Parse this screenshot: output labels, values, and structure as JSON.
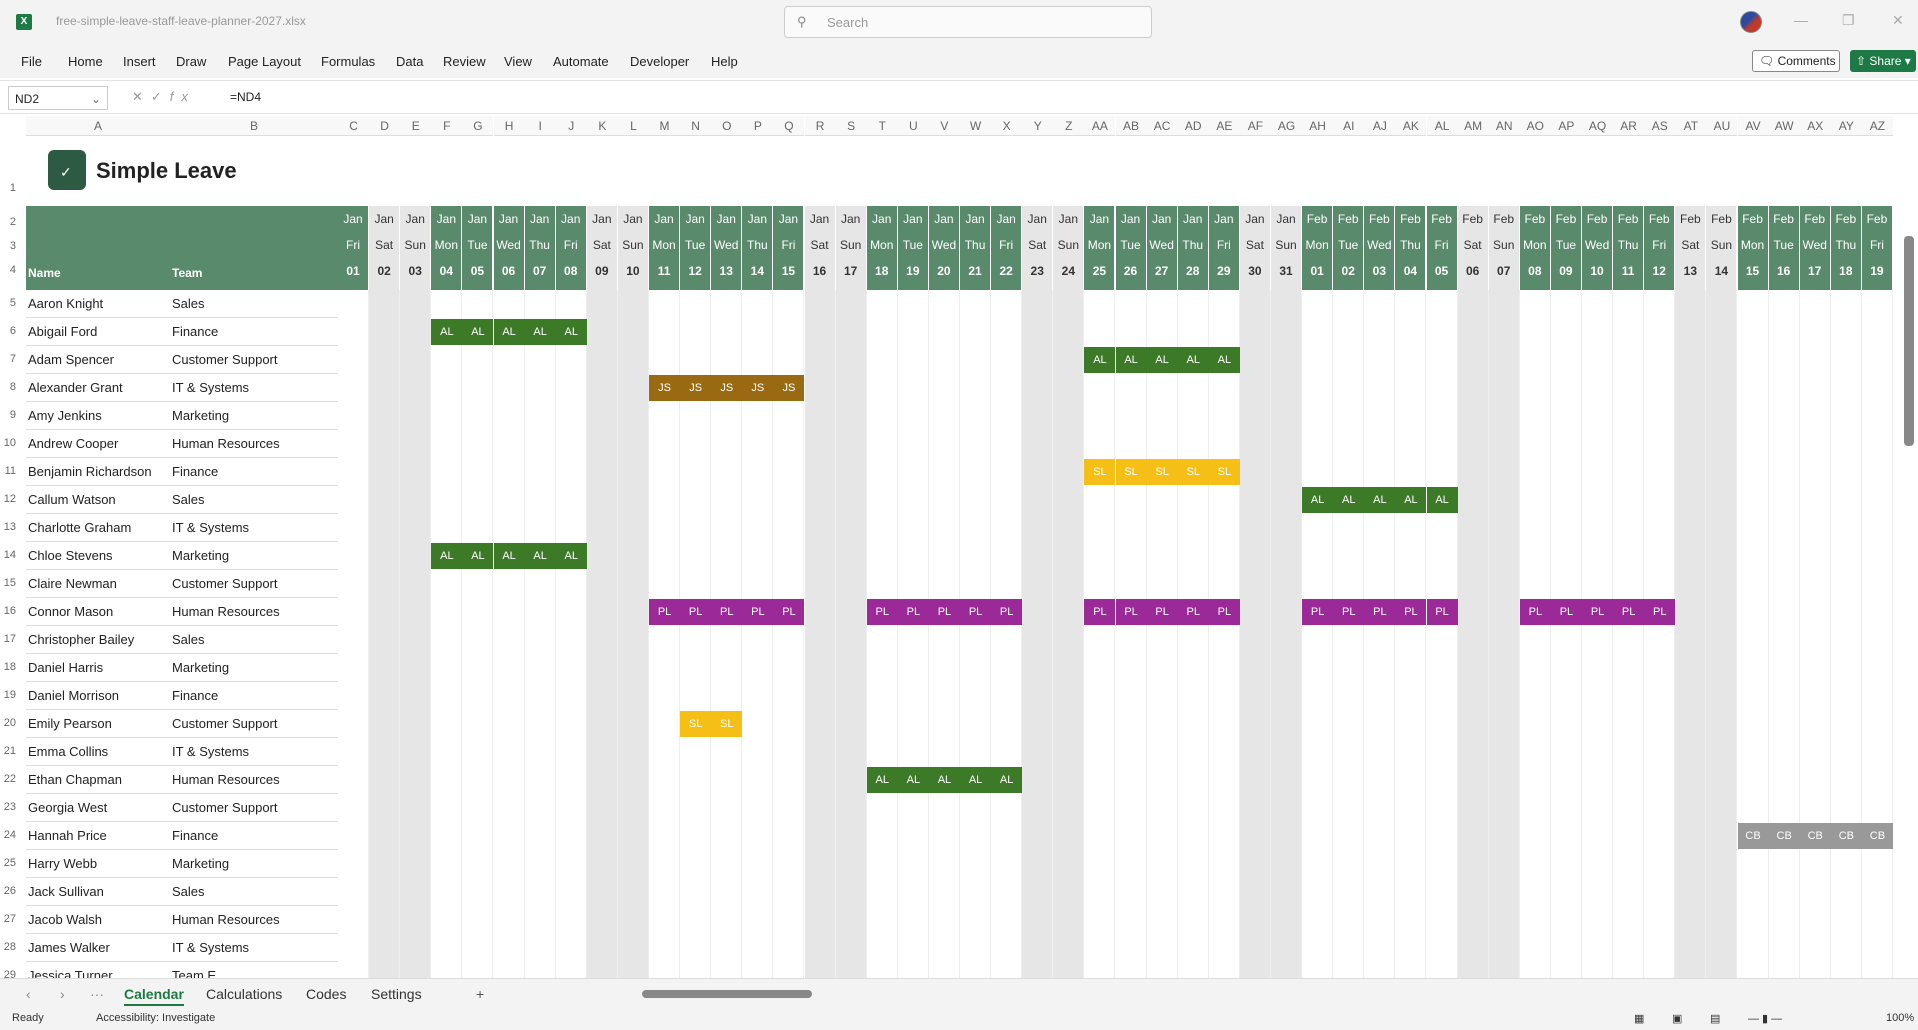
{
  "app": {
    "file_name": "free-simple-leave-staff-leave-planner-2027.xlsx",
    "search_placeholder": "Search",
    "brand_color": "#1d7a45"
  },
  "menu": [
    "File",
    "Home",
    "Insert",
    "Draw",
    "Page Layout",
    "Formulas",
    "Data",
    "Review",
    "View",
    "Automate",
    "Developer",
    "Help"
  ],
  "toolbar": {
    "comments_label": "Comments",
    "share_label": "Share"
  },
  "formula_bar": {
    "name_box": "ND2",
    "fx_label": "fx",
    "formula": "=ND4"
  },
  "sheet": {
    "columns": [
      "A",
      "B",
      "C",
      "D",
      "E",
      "F",
      "G",
      "H",
      "I",
      "J",
      "K",
      "L",
      "M",
      "N",
      "O",
      "P",
      "Q",
      "R",
      "S",
      "T",
      "U",
      "V",
      "W",
      "X",
      "Y",
      "Z",
      "AA",
      "AB",
      "AC",
      "AD",
      "AE",
      "AF",
      "AG",
      "AH",
      "AI",
      "AJ",
      "AK",
      "AL",
      "AM",
      "AN",
      "AO",
      "AP",
      "AQ",
      "AR",
      "AS",
      "AT",
      "AU",
      "AV",
      "AW",
      "AX",
      "AY",
      "AZ"
    ],
    "row_numbers": [
      1,
      2,
      3,
      4,
      5,
      6,
      7,
      8,
      9,
      10,
      11,
      12,
      13,
      14,
      15,
      16,
      17,
      18,
      19,
      20,
      21,
      22,
      23,
      24,
      25,
      26,
      27,
      28,
      29
    ],
    "logo_text": "Simple Leave",
    "header_name": "Name",
    "header_team": "Team",
    "header_color": "#5a8a6c",
    "weekend_color": "#e6e6e6",
    "days": [
      {
        "m": "Jan",
        "wd": "Fri",
        "d": "01"
      },
      {
        "m": "Jan",
        "wd": "Sat",
        "d": "02"
      },
      {
        "m": "Jan",
        "wd": "Sun",
        "d": "03"
      },
      {
        "m": "Jan",
        "wd": "Mon",
        "d": "04"
      },
      {
        "m": "Jan",
        "wd": "Tue",
        "d": "05"
      },
      {
        "m": "Jan",
        "wd": "Wed",
        "d": "06"
      },
      {
        "m": "Jan",
        "wd": "Thu",
        "d": "07"
      },
      {
        "m": "Jan",
        "wd": "Fri",
        "d": "08"
      },
      {
        "m": "Jan",
        "wd": "Sat",
        "d": "09"
      },
      {
        "m": "Jan",
        "wd": "Sun",
        "d": "10"
      },
      {
        "m": "Jan",
        "wd": "Mon",
        "d": "11"
      },
      {
        "m": "Jan",
        "wd": "Tue",
        "d": "12"
      },
      {
        "m": "Jan",
        "wd": "Wed",
        "d": "13"
      },
      {
        "m": "Jan",
        "wd": "Thu",
        "d": "14"
      },
      {
        "m": "Jan",
        "wd": "Fri",
        "d": "15"
      },
      {
        "m": "Jan",
        "wd": "Sat",
        "d": "16"
      },
      {
        "m": "Jan",
        "wd": "Sun",
        "d": "17"
      },
      {
        "m": "Jan",
        "wd": "Mon",
        "d": "18"
      },
      {
        "m": "Jan",
        "wd": "Tue",
        "d": "19"
      },
      {
        "m": "Jan",
        "wd": "Wed",
        "d": "20"
      },
      {
        "m": "Jan",
        "wd": "Thu",
        "d": "21"
      },
      {
        "m": "Jan",
        "wd": "Fri",
        "d": "22"
      },
      {
        "m": "Jan",
        "wd": "Sat",
        "d": "23"
      },
      {
        "m": "Jan",
        "wd": "Sun",
        "d": "24"
      },
      {
        "m": "Jan",
        "wd": "Mon",
        "d": "25"
      },
      {
        "m": "Jan",
        "wd": "Tue",
        "d": "26"
      },
      {
        "m": "Jan",
        "wd": "Wed",
        "d": "27"
      },
      {
        "m": "Jan",
        "wd": "Thu",
        "d": "28"
      },
      {
        "m": "Jan",
        "wd": "Fri",
        "d": "29"
      },
      {
        "m": "Jan",
        "wd": "Sat",
        "d": "30"
      },
      {
        "m": "Jan",
        "wd": "Sun",
        "d": "31"
      },
      {
        "m": "Feb",
        "wd": "Mon",
        "d": "01"
      },
      {
        "m": "Feb",
        "wd": "Tue",
        "d": "02"
      },
      {
        "m": "Feb",
        "wd": "Wed",
        "d": "03"
      },
      {
        "m": "Feb",
        "wd": "Thu",
        "d": "04"
      },
      {
        "m": "Feb",
        "wd": "Fri",
        "d": "05"
      },
      {
        "m": "Feb",
        "wd": "Sat",
        "d": "06"
      },
      {
        "m": "Feb",
        "wd": "Sun",
        "d": "07"
      },
      {
        "m": "Feb",
        "wd": "Mon",
        "d": "08"
      },
      {
        "m": "Feb",
        "wd": "Tue",
        "d": "09"
      },
      {
        "m": "Feb",
        "wd": "Wed",
        "d": "10"
      },
      {
        "m": "Feb",
        "wd": "Thu",
        "d": "11"
      },
      {
        "m": "Feb",
        "wd": "Fri",
        "d": "12"
      },
      {
        "m": "Feb",
        "wd": "Sat",
        "d": "13"
      },
      {
        "m": "Feb",
        "wd": "Sun",
        "d": "14"
      },
      {
        "m": "Feb",
        "wd": "Mon",
        "d": "15"
      },
      {
        "m": "Feb",
        "wd": "Tue",
        "d": "16"
      },
      {
        "m": "Feb",
        "wd": "Wed",
        "d": "17"
      },
      {
        "m": "Feb",
        "wd": "Thu",
        "d": "18"
      },
      {
        "m": "Feb",
        "wd": "Fri",
        "d": "19"
      }
    ],
    "employees": [
      {
        "name": "Aaron Knight",
        "team": "Sales"
      },
      {
        "name": "Abigail Ford",
        "team": "Finance"
      },
      {
        "name": "Adam Spencer",
        "team": "Customer Support"
      },
      {
        "name": "Alexander Grant",
        "team": "IT & Systems"
      },
      {
        "name": "Amy Jenkins",
        "team": "Marketing"
      },
      {
        "name": "Andrew Cooper",
        "team": "Human Resources"
      },
      {
        "name": "Benjamin Richardson",
        "team": "Finance"
      },
      {
        "name": "Callum Watson",
        "team": "Sales"
      },
      {
        "name": "Charlotte Graham",
        "team": "IT & Systems"
      },
      {
        "name": "Chloe Stevens",
        "team": "Marketing"
      },
      {
        "name": "Claire Newman",
        "team": "Customer Support"
      },
      {
        "name": "Connor Mason",
        "team": "Human Resources"
      },
      {
        "name": "Christopher Bailey",
        "team": "Sales"
      },
      {
        "name": "Daniel Harris",
        "team": "Marketing"
      },
      {
        "name": "Daniel Morrison",
        "team": "Finance"
      },
      {
        "name": "Emily Pearson",
        "team": "Customer Support"
      },
      {
        "name": "Emma Collins",
        "team": "IT & Systems"
      },
      {
        "name": "Ethan Chapman",
        "team": "Human Resources"
      },
      {
        "name": "Georgia West",
        "team": "Customer Support"
      },
      {
        "name": "Hannah Price",
        "team": "Finance"
      },
      {
        "name": "Harry Webb",
        "team": "Marketing"
      },
      {
        "name": "Jack Sullivan",
        "team": "Sales"
      },
      {
        "name": "Jacob Walsh",
        "team": "Human Resources"
      },
      {
        "name": "James Walker",
        "team": "IT & Systems"
      },
      {
        "name": "Jessica Turner",
        "team": "Team E"
      }
    ],
    "leave_colors": {
      "AL": "#3d7a27",
      "JS": "#9a6a12",
      "SL": "#f5bf15",
      "PL": "#9b2a98",
      "CB": "#999999"
    },
    "leaves": [
      {
        "row": 1,
        "code": "AL",
        "days": [
          3,
          4,
          5,
          6,
          7
        ]
      },
      {
        "row": 2,
        "code": "AL",
        "days": [
          24,
          25,
          26,
          27,
          28
        ]
      },
      {
        "row": 3,
        "code": "JS",
        "days": [
          10,
          11,
          12,
          13,
          14
        ]
      },
      {
        "row": 6,
        "code": "SL",
        "days": [
          24,
          25,
          26,
          27,
          28
        ]
      },
      {
        "row": 7,
        "code": "AL",
        "days": [
          31,
          32,
          33,
          34,
          35
        ]
      },
      {
        "row": 9,
        "code": "AL",
        "days": [
          3,
          4,
          5,
          6,
          7
        ]
      },
      {
        "row": 11,
        "code": "PL",
        "days": [
          10,
          11,
          12,
          13,
          14
        ]
      },
      {
        "row": 11,
        "code": "PL",
        "days": [
          17,
          18,
          19,
          20,
          21
        ]
      },
      {
        "row": 11,
        "code": "PL",
        "days": [
          24,
          25,
          26,
          27,
          28
        ]
      },
      {
        "row": 11,
        "code": "PL",
        "days": [
          31,
          32,
          33,
          34,
          35
        ]
      },
      {
        "row": 11,
        "code": "PL",
        "days": [
          38,
          39,
          40,
          41,
          42
        ]
      },
      {
        "row": 15,
        "code": "SL",
        "days": [
          11,
          12
        ]
      },
      {
        "row": 17,
        "code": "AL",
        "days": [
          17,
          18,
          19,
          20,
          21
        ]
      },
      {
        "row": 19,
        "code": "CB",
        "days": [
          45,
          46,
          47,
          48,
          49
        ]
      }
    ]
  },
  "tabs": [
    "Calendar",
    "Calculations",
    "Codes",
    "Settings"
  ],
  "active_tab": "Calendar",
  "status": {
    "ready": "Ready",
    "accessibility": "Accessibility: Investigate",
    "zoom": "100%"
  }
}
